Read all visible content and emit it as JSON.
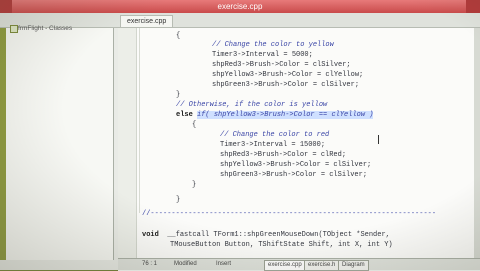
{
  "window": {
    "title": "exercise.cpp"
  },
  "tabs": [
    {
      "label": "exercise.cpp"
    }
  ],
  "left_panel": {
    "item": "frmFlight - Classes"
  },
  "code": {
    "l1": "{",
    "l2": "// Change the color to yellow",
    "l3": "Timer3->Interval = 5000;",
    "l4": "shpRed3->Brush->Color = clSilver;",
    "l5": "shpYellow3->Brush->Color = clYellow;",
    "l6": "shpGreen3->Brush->Color = clSilver;",
    "l7": "}",
    "l8": "// Otherwise, if the color is yellow",
    "l9_kw": "else",
    "l9_rest": "if( shpYellow3->Brush->Color == clYellow )",
    "l10": "{",
    "l11": "// Change the color to red",
    "l12": "Timer3->Interval = 15000;",
    "l13": "shpRed3->Brush->Color = clRed;",
    "l14": "shpYellow3->Brush->Color = clSilver;",
    "l15": "shpGreen3->Brush->Color = clSilver;",
    "l16": "}",
    "l17": "}",
    "l18": "//--------------------------------------------------------------------",
    "l19a": "void",
    "l19b": "__fastcall TForm1::shpGreenMouseDown(TObject *Sender,",
    "l20": "TMouseButton Button, TShiftState Shift, int X, int Y)"
  },
  "status": {
    "pos": "76 : 1",
    "modified": "Modified",
    "insert": "Insert",
    "tab1": "exercise.cpp",
    "tab2": "exercise.h",
    "tab3": "Diagram"
  }
}
